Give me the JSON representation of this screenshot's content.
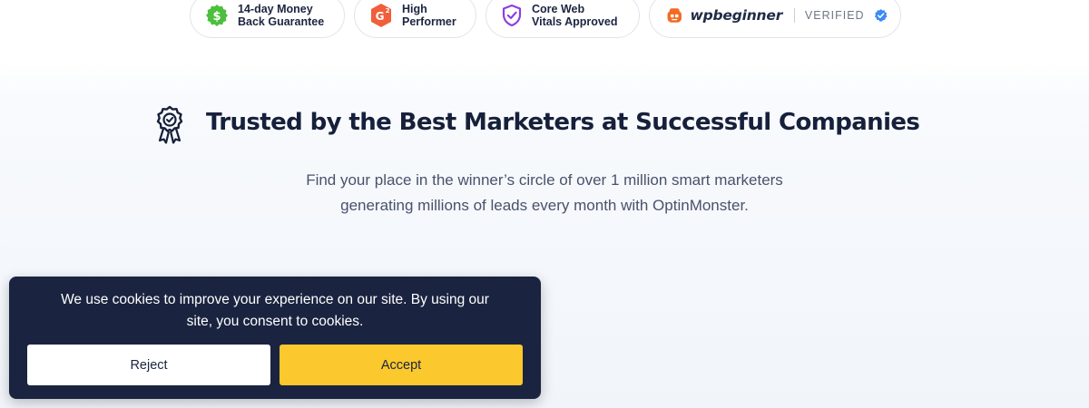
{
  "badges": [
    {
      "icon": "dollar-icon",
      "line1": "14-day Money",
      "line2": "Back Guarantee",
      "color": "#4cbf3e"
    },
    {
      "icon": "g2-icon",
      "line1": "High",
      "line2": "Performer",
      "color": "#f05f3a"
    },
    {
      "icon": "shield-check-icon",
      "line1": "Core Web",
      "line2": "Vitals Approved",
      "color": "#8c3fe0"
    },
    {
      "icon": "wpbeginner-logo-icon",
      "brand": "wpbeginner",
      "status": "VERIFIED",
      "color": "#f26b21"
    }
  ],
  "g2_superscript": "2",
  "trust": {
    "icon": "award-ribbon-icon",
    "heading": "Trusted by the Best Marketers at Successful Companies",
    "subtitle_line1": "Find your place in the winner’s circle of over 1 million smart marketers",
    "subtitle_line2": "generating millions of leads every month with OptinMonster."
  },
  "cookie_banner": {
    "message_line1": "We use cookies to improve your experience on our site. By using our",
    "message_line2": "site, you consent to cookies.",
    "reject_label": "Reject",
    "accept_label": "Accept",
    "background": "#1a2440",
    "accept_color": "#fbc82d"
  }
}
